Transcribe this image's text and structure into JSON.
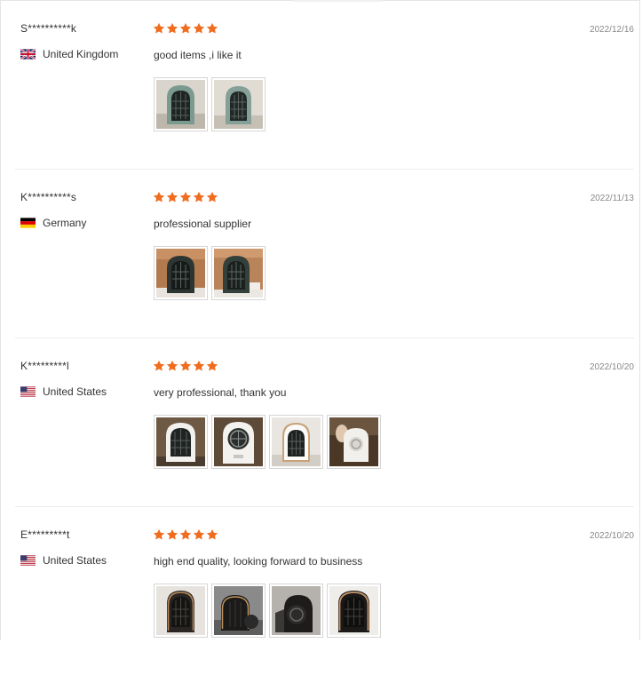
{
  "reviews": [
    {
      "author": "S**********k",
      "country": "United Kingdom",
      "flag": "uk-flag-icon",
      "rating": 5,
      "date": "2022/12/16",
      "comment": "good items ,i like it",
      "photos": [
        "photo-1",
        "photo-2"
      ]
    },
    {
      "author": "K**********s",
      "country": "Germany",
      "flag": "germany-flag-icon",
      "rating": 5,
      "date": "2022/11/13",
      "comment": "professional supplier",
      "photos": [
        "photo-1",
        "photo-2"
      ]
    },
    {
      "author": "K*********l",
      "country": "United States",
      "flag": "us-flag-icon",
      "rating": 5,
      "date": "2022/10/20",
      "comment": "very professional, thank you",
      "photos": [
        "photo-1",
        "photo-2",
        "photo-3",
        "photo-4"
      ]
    },
    {
      "author": "E*********t",
      "country": "United States",
      "flag": "us-flag-icon",
      "rating": 5,
      "date": "2022/10/20",
      "comment": "high end quality, looking forward to business",
      "photos": [
        "photo-1",
        "photo-2",
        "photo-3",
        "photo-4"
      ]
    }
  ],
  "colors": {
    "star": "#f06d1f",
    "divider": "#ececec",
    "date": "#888888",
    "text": "#333333"
  }
}
